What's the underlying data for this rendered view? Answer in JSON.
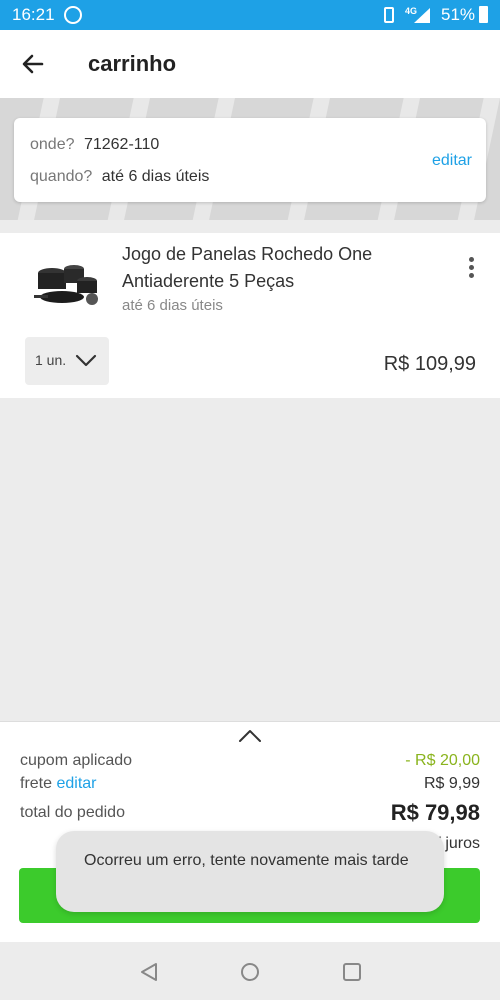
{
  "status_bar": {
    "time": "16:21",
    "network": "4G",
    "battery": "51%",
    "icons": [
      "whatsapp-icon",
      "vibrate-icon",
      "signal-icon",
      "battery-icon"
    ]
  },
  "header": {
    "title": "carrinho"
  },
  "delivery": {
    "where_label": "onde?",
    "where_value": "71262-110",
    "when_label": "quando?",
    "when_value": "até 6 dias úteis",
    "edit_label": "editar"
  },
  "cart_item": {
    "name": "Jogo de Panelas Rochedo One Antiaderente 5 Peças",
    "eta": "até 6 dias úteis",
    "quantity": "1 un.",
    "price": "R$ 109,99"
  },
  "summary": {
    "coupon_label": "cupom aplicado",
    "coupon_value": "- R$ 20,00",
    "shipping_label": "frete",
    "shipping_edit": "editar",
    "shipping_value": "R$ 9,99",
    "total_label": "total do pedido",
    "total_value": "R$ 79,98",
    "installments": "Em até 3x s/ juros"
  },
  "toast": {
    "message": "Ocorreu um erro, tente novamente mais tarde"
  },
  "colors": {
    "status_bar": "#1ea1e6",
    "accent": "#1ea1e6",
    "coupon": "#8ab41e",
    "cta": "#3ccb2c"
  }
}
